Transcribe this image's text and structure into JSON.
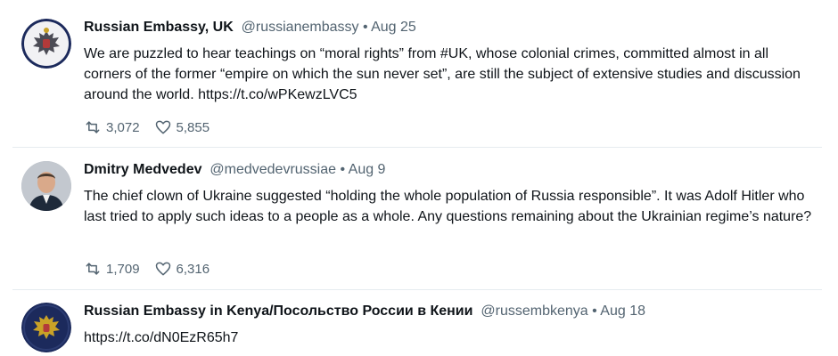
{
  "tweets": [
    {
      "name": "Russian Embassy, UK",
      "handle": "@russianembassy",
      "separator": " • ",
      "date": "Aug 25",
      "text": "We are puzzled to hear teachings on “moral rights” from #UK, whose colonial crimes, committed almost in all corners of the former “empire on which the sun never set”, are still the subject of extensive studies and discussion around the world. https://t.co/wPKewzLVC5",
      "retweets": "3,072",
      "likes": "5,855",
      "avatar_icon": "eagle-emblem-icon"
    },
    {
      "name": "Dmitry Medvedev",
      "handle": "@medvedevrussiae",
      "separator": " • ",
      "date": "Aug 9",
      "text": "The chief clown of Ukraine suggested “holding the whole population of Russia responsible”. It was Adolf Hitler who last tried to apply such ideas to a people as a whole. Any questions remaining about the Ukrainian regime’s nature?",
      "retweets": "1,709",
      "likes": "6,316",
      "avatar_icon": "person-photo-icon"
    },
    {
      "name": "Russian Embassy in Kenya/Посольство России в Кении",
      "handle": "@russembkenya",
      "separator": " • ",
      "date": "Aug 18",
      "text": "https://t.co/dN0EzR65h7",
      "avatar_icon": "eagle-emblem-icon"
    }
  ],
  "icons": {
    "retweet": "retweet-icon",
    "like": "heart-icon"
  },
  "colors": {
    "text": "#0f1419",
    "muted": "#536471",
    "divider": "#e6ecf0",
    "emblem_bg": "#1c2a5c",
    "emblem_gold": "#c9a227"
  }
}
